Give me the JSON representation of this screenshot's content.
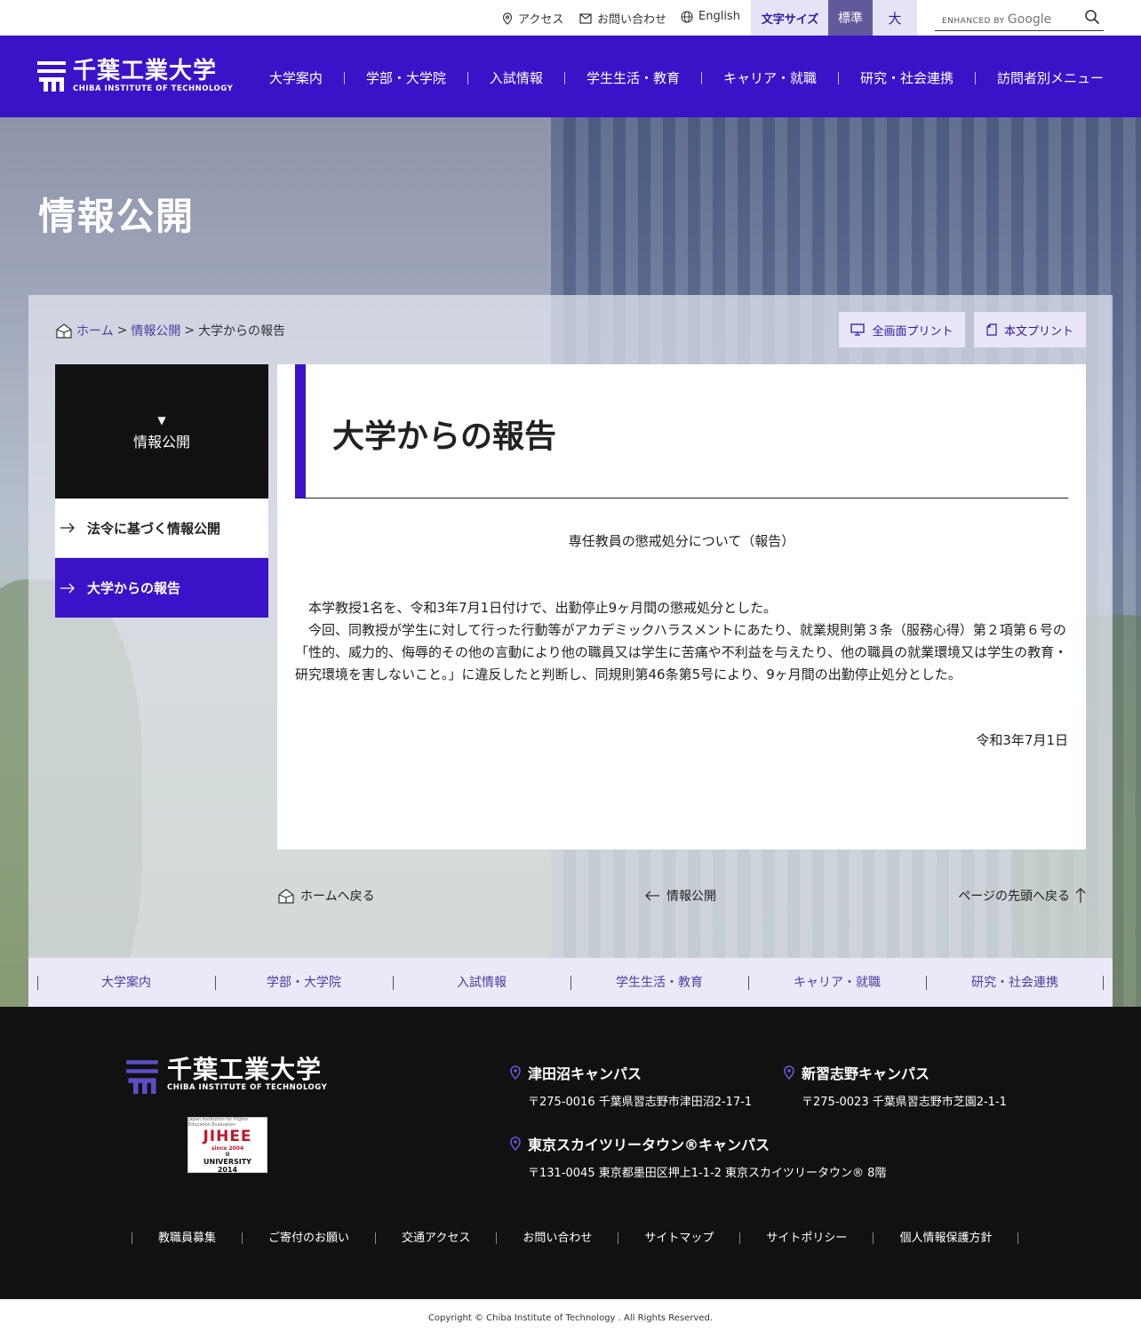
{
  "util": {
    "access": "アクセス",
    "contact": "お問い合わせ",
    "english": "English",
    "font_size_label": "文字サイズ",
    "font_standard": "標準",
    "font_large": "大",
    "search_brand_prefix": "ENHANCED BY",
    "search_brand": "Google"
  },
  "header": {
    "logo_jp": "千葉工業大学",
    "logo_en": "CHIBA INSTITUTE OF TECHNOLOGY",
    "nav": [
      "大学案内",
      "学部・大学院",
      "入試情報",
      "学生生活・教育",
      "キャリア・就職",
      "研究・社会連携",
      "訪問者別メニュー"
    ]
  },
  "hero": {
    "title": "情報公開"
  },
  "breadcrumb": {
    "home": "ホーム",
    "sep": ">",
    "parent": "情報公開",
    "current": "大学からの報告"
  },
  "print": {
    "full": "全画面プリント",
    "body": "本文プリント"
  },
  "sidenav": {
    "title": "情報公開",
    "items": [
      {
        "label": "法令に基づく情報公開"
      },
      {
        "label": "大学からの報告"
      }
    ]
  },
  "main": {
    "heading": "大学からの報告",
    "doc_title": "専任教員の懲戒処分について（報告）",
    "paragraphs": [
      "　本学教授1名を、令和3年7月1日付けで、出勤停止9ヶ月間の懲戒処分とした。",
      "　今回、同教授が学生に対して行った行動等がアカデミックハラスメントにあたり、就業規則第３条（服務心得）第２項第６号の「性的、威力的、侮辱的その他の言動により他の職員又は学生に苦痛や不利益を与えたり、他の職員の就業環境又は学生の教育・研究環境を害しないこと。」に違反したと判断し、同規則第46条第5号により、9ヶ月間の出勤停止処分とした。"
    ],
    "date": "令和3年7月1日"
  },
  "bottom_links": {
    "home": "ホームへ戻る",
    "back": "情報公開",
    "top": "ページの先頭へ戻る"
  },
  "subnav": [
    "大学案内",
    "学部・大学院",
    "入試情報",
    "学生生活・教育",
    "キャリア・就職",
    "研究・社会連携"
  ],
  "footer": {
    "logo_jp": "千葉工業大学",
    "logo_en": "CHIBA INSTITUTE OF TECHNOLOGY",
    "badge": {
      "top": "Japan Institution for Higher Education Evaluation",
      "main": "JIHEE",
      "since": "since 2004",
      "roman": "II",
      "univ": "UNIVERSITY",
      "year": "2014"
    },
    "campuses": [
      {
        "name": "津田沼キャンパス",
        "addr": "〒275-0016 千葉県習志野市津田沼2-17-1"
      },
      {
        "name": "新習志野キャンパス",
        "addr": "〒275-0023 千葉県習志野市芝園2-1-1"
      },
      {
        "name": "東京スカイツリータウン®キャンパス",
        "addr": "〒131-0045 東京都墨田区押上1-1-2 東京スカイツリータウン® 8階"
      }
    ],
    "links": [
      "教職員募集",
      "ご寄付のお願い",
      "交通アクセス",
      "お問い合わせ",
      "サイトマップ",
      "サイトポリシー",
      "個人情報保護方針"
    ],
    "copyright": "Copyright © Chiba Institute of Technology . All Rights Reserved."
  },
  "colors": {
    "brand": "#3a13c8",
    "accent_light": "#e6e3f7",
    "footer_bg": "#111111"
  }
}
